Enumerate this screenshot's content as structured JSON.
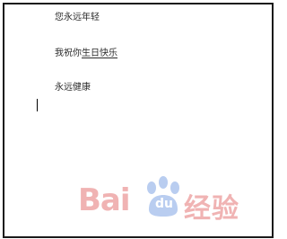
{
  "document": {
    "lines": [
      {
        "text": "您永远年轻"
      },
      {
        "prefix": "我祝你",
        "underlined": "生日快乐"
      },
      {
        "text": "永远健康"
      }
    ]
  },
  "watermark": {
    "bai": "Bai",
    "du": "du",
    "cn": "经验",
    "color": "#f0b3b3",
    "paw_color": "#b9cdf0"
  }
}
